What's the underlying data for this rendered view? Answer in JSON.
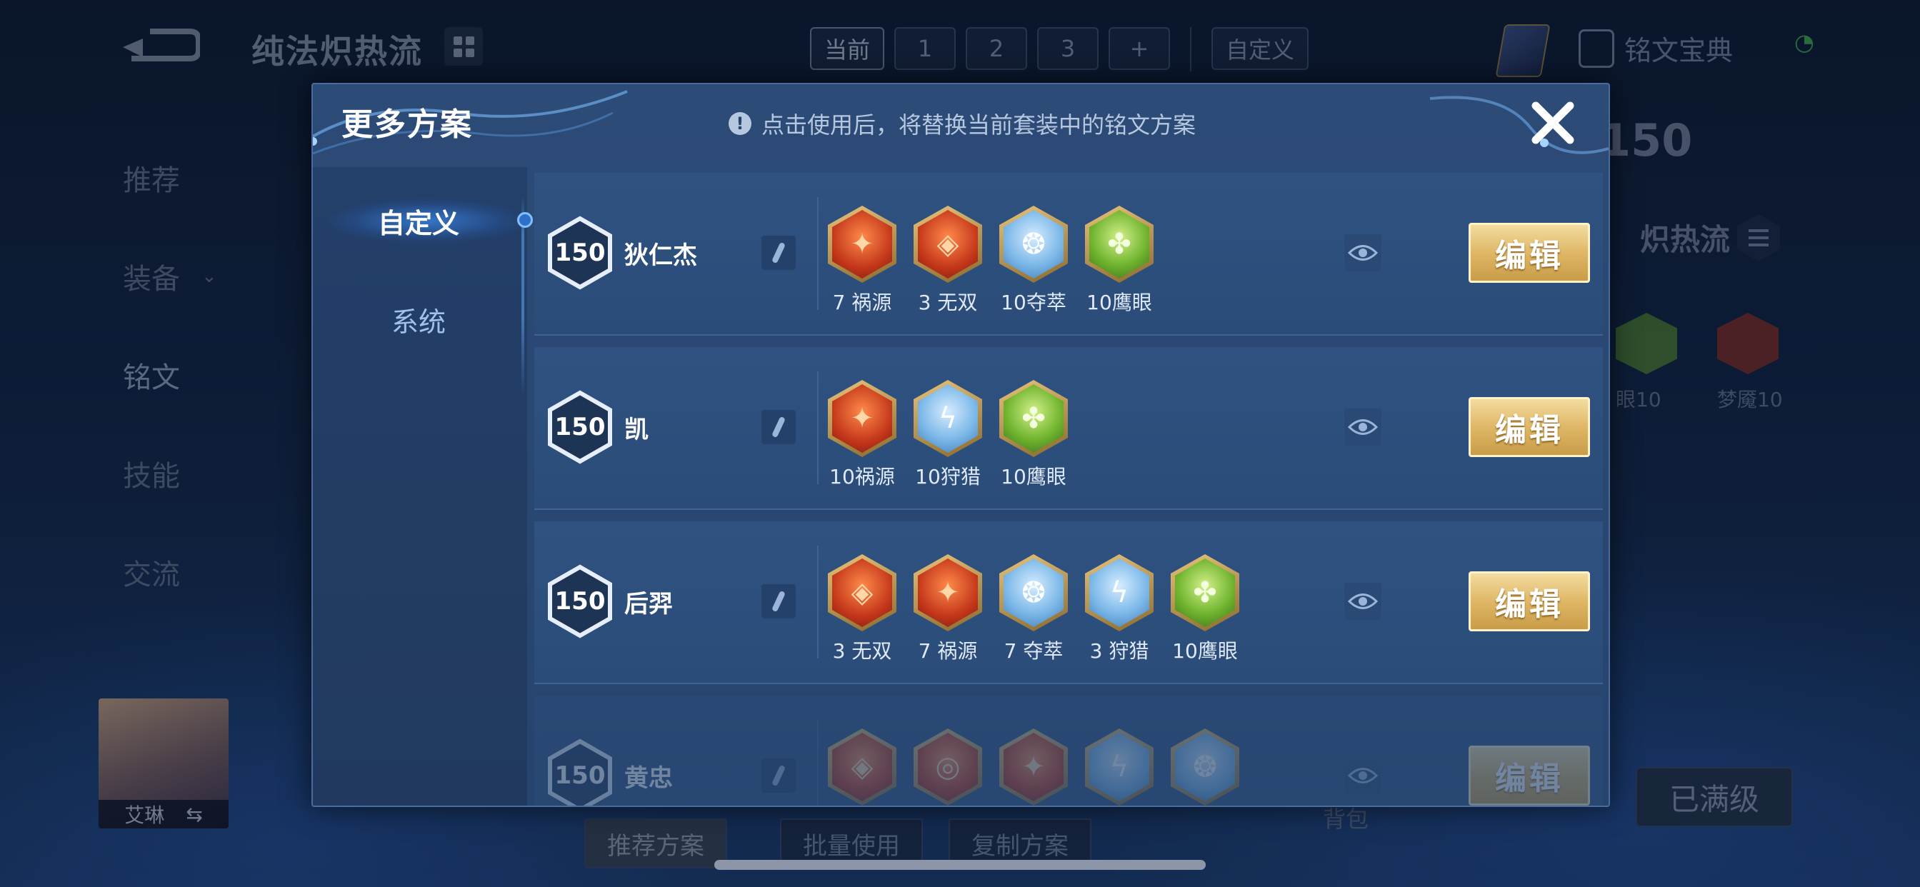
{
  "background": {
    "plan_title": "纯法炽热流",
    "top_tabs": [
      "当前",
      "1",
      "2",
      "3",
      "+"
    ],
    "custom_tab": "自定义",
    "codex_label": "铭文宝典",
    "side_nav": [
      "推荐",
      "装备",
      "铭文",
      "技能",
      "交流"
    ],
    "hero_name": "艾琳",
    "swap_icon_glyph": "⇆",
    "level_partial": "150",
    "plan_name_partial": "炽热流",
    "rune_labels": [
      "眼10",
      "梦魇10"
    ],
    "bottom_buttons": [
      "推荐方案",
      "批量使用",
      "复制方案"
    ],
    "bag_label": "背包",
    "maxed_label": "已满级"
  },
  "modal": {
    "title": "更多方案",
    "notice": "点击使用后，将替换当前套装中的铭文方案",
    "notice_icon": "!",
    "close_icon": "close-icon",
    "tabs": [
      "自定义",
      "系统"
    ],
    "active_tab": "自定义",
    "edit_label": "编辑",
    "rows": [
      {
        "level": "150",
        "hero": "狄仁杰",
        "runes": [
          {
            "count": "7",
            "name": "祸源",
            "color": "red"
          },
          {
            "count": "3",
            "name": "无双",
            "color": "red"
          },
          {
            "count": "10",
            "name": "夺萃",
            "color": "blue"
          },
          {
            "count": "10",
            "name": "鹰眼",
            "color": "green"
          }
        ]
      },
      {
        "level": "150",
        "hero": "凯",
        "runes": [
          {
            "count": "10",
            "name": "祸源",
            "color": "red"
          },
          {
            "count": "10",
            "name": "狩猎",
            "color": "blue"
          },
          {
            "count": "10",
            "name": "鹰眼",
            "color": "green"
          }
        ]
      },
      {
        "level": "150",
        "hero": "后羿",
        "runes": [
          {
            "count": "3",
            "name": "无双",
            "color": "red"
          },
          {
            "count": "7",
            "name": "祸源",
            "color": "red"
          },
          {
            "count": "7",
            "name": "夺萃",
            "color": "blue"
          },
          {
            "count": "3",
            "name": "狩猎",
            "color": "blue"
          },
          {
            "count": "10",
            "name": "鹰眼",
            "color": "green"
          }
        ]
      },
      {
        "level": "150",
        "hero": "黄忠",
        "runes": [
          {
            "count": "",
            "name": "",
            "color": "red"
          },
          {
            "count": "",
            "name": "",
            "color": "red"
          },
          {
            "count": "",
            "name": "",
            "color": "red"
          },
          {
            "count": "",
            "name": "",
            "color": "blue"
          },
          {
            "count": "",
            "name": "",
            "color": "blue"
          }
        ]
      }
    ]
  },
  "colors": {
    "modal_bg": "#2c4b76",
    "edit_gold": "#dfb766",
    "accent_blue": "#5f9be8"
  }
}
